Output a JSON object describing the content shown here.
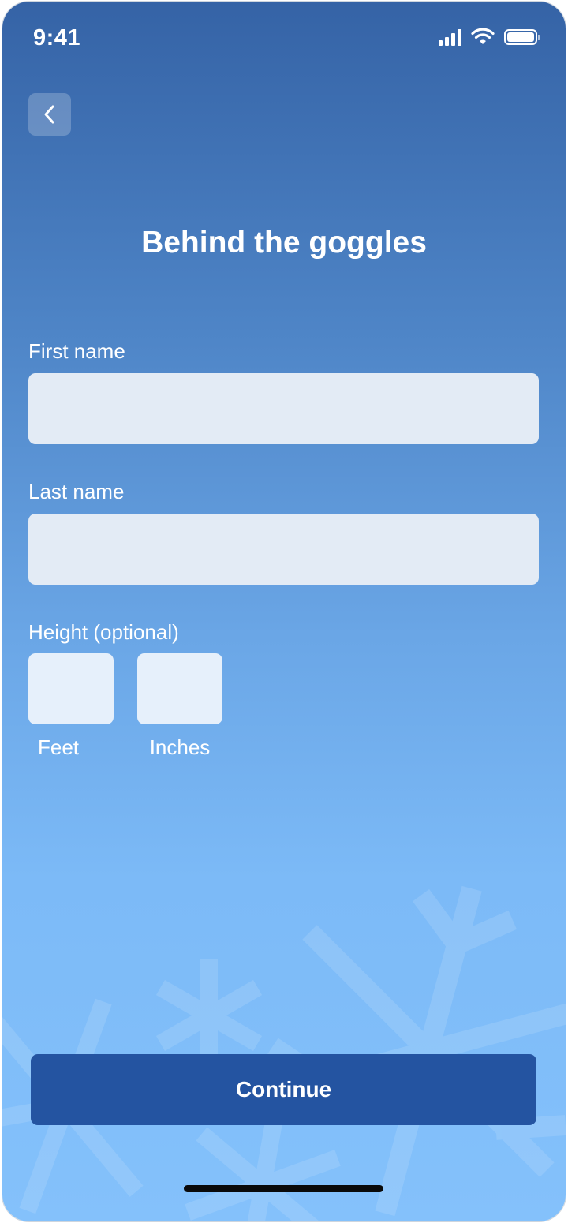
{
  "status_bar": {
    "time": "9:41",
    "icons": [
      "cellular-signal-icon",
      "wifi-icon",
      "battery-icon"
    ]
  },
  "header": {
    "back_icon": "chevron-left-icon",
    "title": "Behind the goggles"
  },
  "form": {
    "first_name": {
      "label": "First name",
      "value": ""
    },
    "last_name": {
      "label": "Last name",
      "value": ""
    },
    "height": {
      "label": "Height (optional)",
      "feet": {
        "label": "Feet",
        "value": ""
      },
      "inches": {
        "label": "Inches",
        "value": ""
      }
    }
  },
  "footer": {
    "continue_label": "Continue"
  },
  "colors": {
    "gradient_top": "#3563a6",
    "gradient_bottom": "#84c1fb",
    "field_background": "#e3ebf5",
    "button_background": "#2454a1",
    "text": "#ffffff"
  }
}
